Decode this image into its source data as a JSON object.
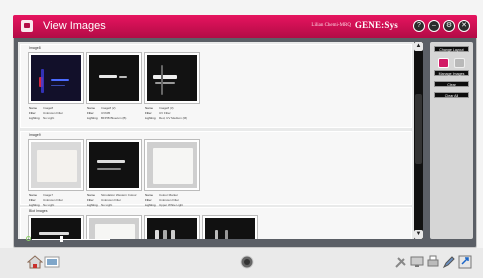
{
  "window": {
    "title": "View Images",
    "user_name": "Lilian Chemi-MRQ",
    "brand": "GENE:Sys",
    "buttons": [
      {
        "name": "help",
        "glyph": "?"
      },
      {
        "name": "minimize",
        "glyph": "–"
      },
      {
        "name": "settings",
        "glyph": "⚙"
      },
      {
        "name": "close",
        "glyph": "✕"
      }
    ]
  },
  "groups": [
    {
      "title": "Image8",
      "items": [
        {
          "name": "Image8",
          "filter": "Unknown Filter",
          "lighting": "No Light",
          "style": "blue"
        },
        {
          "name": "Image8 (2)",
          "filter": "UV605",
          "lighting": "BFP/B Blue/em (B)",
          "style": "dark"
        },
        {
          "name": "Image8 (3)",
          "filter": "UV Filter",
          "lighting": "Red, UV Medium (M)",
          "style": "dark2"
        }
      ]
    },
    {
      "title": "Image9",
      "items": [
        {
          "name": "Image7",
          "filter": "Unknown Filter",
          "lighting": "No Light",
          "style": "white"
        },
        {
          "name": "Simulation Western Colour",
          "filter": "Unknown Filter",
          "lighting": "No Light",
          "style": "dark"
        },
        {
          "name": "Colour Marker",
          "filter": "Unknown Filter",
          "lighting": "Upper White Light",
          "style": "white"
        }
      ]
    },
    {
      "title": "Blot Images",
      "items": [
        {
          "name": "",
          "filter": "",
          "lighting": "",
          "style": "dark"
        },
        {
          "name": "",
          "filter": "",
          "lighting": "",
          "style": "white"
        },
        {
          "name": "",
          "filter": "",
          "lighting": "",
          "style": "dark"
        },
        {
          "name": "",
          "filter": "",
          "lighting": "",
          "style": "dark"
        }
      ]
    }
  ],
  "meta_labels": {
    "name": "Name",
    "filter": "Filter",
    "lighting": "Lighting"
  },
  "right_panel": {
    "change_layout": "Change Layout",
    "manage_images": "Manage Images",
    "clear": "Clear",
    "clear_all": "Clear All"
  },
  "colors": {
    "titlebar": "#d0104f",
    "accent": "#c8155b"
  }
}
